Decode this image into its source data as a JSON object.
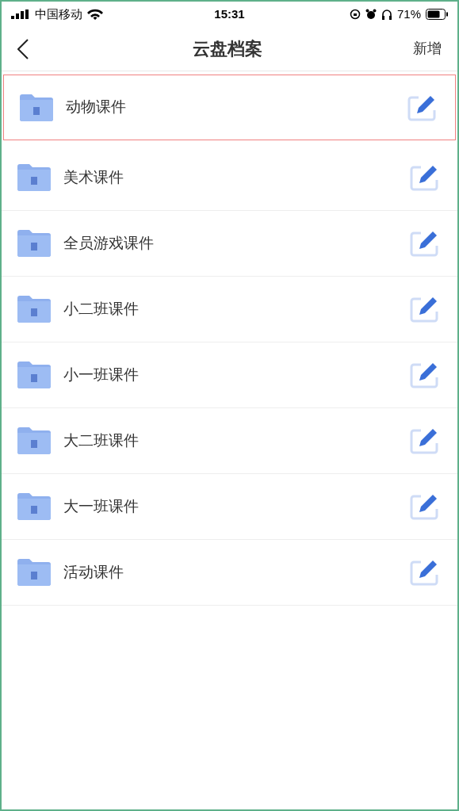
{
  "status_bar": {
    "carrier": "中国移动",
    "time": "15:31",
    "battery": "71%"
  },
  "nav": {
    "title": "云盘档案",
    "action": "新增"
  },
  "folders": [
    {
      "name": "动物课件",
      "selected": true
    },
    {
      "name": "美术课件",
      "selected": false
    },
    {
      "name": "全员游戏课件",
      "selected": false
    },
    {
      "name": "小二班课件",
      "selected": false
    },
    {
      "name": "小一班课件",
      "selected": false
    },
    {
      "name": "大二班课件",
      "selected": false
    },
    {
      "name": "大一班课件",
      "selected": false
    },
    {
      "name": "活动课件",
      "selected": false
    }
  ]
}
